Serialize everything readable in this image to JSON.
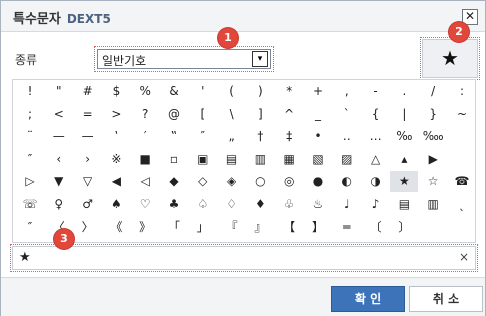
{
  "title": {
    "main": "특수문자",
    "sub": "DEXT5"
  },
  "close_label": "✕",
  "category": {
    "label": "종류",
    "value": "일반기호",
    "arrow": "▾"
  },
  "preview_char": "★",
  "rows": [
    [
      "!",
      "\"",
      "#",
      "$",
      "%",
      "&",
      "'",
      "(",
      ")",
      "*",
      "+",
      ",",
      "-",
      ".",
      "/",
      ":"
    ],
    [
      ";",
      "<",
      "=",
      ">",
      "?",
      "@",
      "[",
      "\\",
      "]",
      "^",
      "_",
      "`",
      "{",
      "|",
      "}",
      "~"
    ],
    [
      "¨",
      "—",
      "—",
      "‛",
      "′",
      "‟",
      "″",
      "„",
      "†",
      "‡",
      "•",
      "‥",
      "…",
      "‰",
      "‱"
    ],
    [
      "″",
      "‹",
      "›",
      "※",
      "■",
      "▫",
      "▣",
      "▤",
      "▥",
      "▦",
      "▧",
      "▨",
      "△",
      "▴",
      "▶"
    ],
    [
      "▷",
      "▼",
      "▽",
      "◀",
      "◁",
      "◆",
      "◇",
      "◈",
      "○",
      "◎",
      "●",
      "◐",
      "◑",
      "★",
      "☆",
      "☎"
    ],
    [
      "☏",
      "♀",
      "♂",
      "♠",
      "♡",
      "♣",
      "♤",
      "♢",
      "♦",
      "♧",
      "♨",
      "♩",
      "♪",
      "▤",
      "▥",
      "ˎ",
      "˚"
    ],
    [
      "″",
      "〈",
      "〉",
      "《",
      "》",
      "「",
      "」",
      "『",
      "』",
      "【",
      "】",
      "═",
      "〔",
      "〕"
    ]
  ],
  "selected": {
    "row": 4,
    "col": 13
  },
  "input": {
    "value": "★",
    "clear": "×"
  },
  "buttons": {
    "ok": "확 인",
    "cancel": "취 소"
  },
  "badges": [
    "1",
    "2",
    "3"
  ]
}
